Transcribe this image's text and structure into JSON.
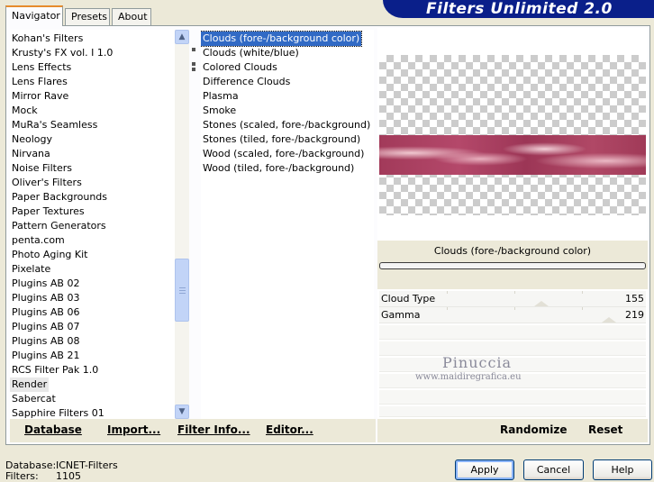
{
  "tabs": [
    {
      "label": "Navigator",
      "active": true
    },
    {
      "label": "Presets",
      "active": false
    },
    {
      "label": "About",
      "active": false
    }
  ],
  "banner": {
    "title": "Filters Unlimited 2.0"
  },
  "categories": {
    "items": [
      "Kohan's Filters",
      "Krusty's FX vol. I 1.0",
      "Lens Effects",
      "Lens Flares",
      "Mirror Rave",
      "Mock",
      "MuRa's Seamless",
      "Neology",
      "Nirvana",
      "Noise Filters",
      "Oliver's Filters",
      "Paper Backgrounds",
      "Paper Textures",
      "Pattern Generators",
      "penta.com",
      "Photo Aging Kit",
      "Pixelate",
      "Plugins AB 02",
      "Plugins AB 03",
      "Plugins AB 06",
      "Plugins AB 07",
      "Plugins AB 08",
      "Plugins AB 21",
      "RCS Filter Pak 1.0",
      "Render",
      "Sabercat",
      "Sapphire Filters 01"
    ],
    "selected": "Render"
  },
  "filters": {
    "items": [
      "Clouds (fore-/background color)",
      "Clouds (white/blue)",
      "Colored Clouds",
      "Difference Clouds",
      "Plasma",
      "Smoke",
      "Stones (scaled, fore-/background)",
      "Stones (tiled, fore-/background)",
      "Wood (scaled, fore-/background)",
      "Wood (tiled, fore-/background)"
    ],
    "selected": "Clouds (fore-/background color)"
  },
  "left_toolbar": {
    "database": "Database",
    "import": "Import...",
    "filter_info": "Filter Info...",
    "editor": "Editor..."
  },
  "preview": {
    "caption": "Clouds (fore-/background color)"
  },
  "params": [
    {
      "label": "Cloud Type",
      "value": "155"
    },
    {
      "label": "Gamma",
      "value": "219"
    }
  ],
  "watermark": {
    "name": "Pinuccia",
    "url": "www.maidiregrafica.eu"
  },
  "right_toolbar": {
    "randomize": "Randomize",
    "reset": "Reset"
  },
  "footer": {
    "database_label": "Database:",
    "database_value": "ICNET-Filters",
    "filters_label": "Filters:",
    "filters_value": "1105"
  },
  "buttons": {
    "apply": "Apply",
    "cancel": "Cancel",
    "help": "Help"
  },
  "colors": {
    "banner": "#0a1f8a",
    "selection": "#316ac5"
  }
}
